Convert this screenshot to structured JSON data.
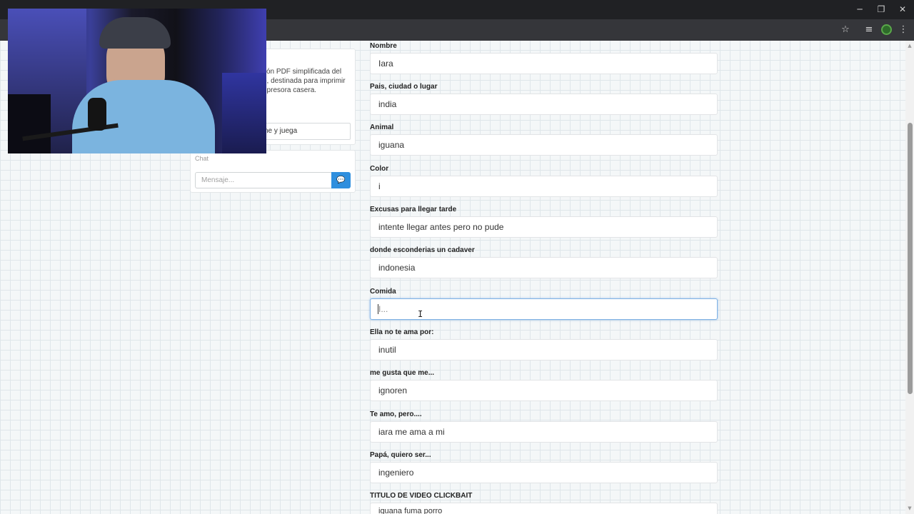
{
  "panel": {
    "description_lines": [
      "ón PDF simplificada del",
      "o, destinada para imprimir",
      "npresora casera."
    ],
    "share_text": "ne y juega",
    "chat_title": "Chat",
    "chat_placeholder": "Mensaje..."
  },
  "form": {
    "fields": [
      {
        "label": "Nombre",
        "value": ""
      },
      {
        "label": "Pais, ciudad o lugar",
        "value": "india"
      },
      {
        "label": "Animal",
        "value": "iguana"
      },
      {
        "label": "Color",
        "value": "i"
      },
      {
        "label": "Excusas para llegar tarde",
        "value": "intente llegar antes pero no pude"
      },
      {
        "label": "donde esconderias un cadaver",
        "value": "indonesia"
      },
      {
        "label": "Comida",
        "value": "",
        "placeholder": "I..."
      },
      {
        "label": "Ella no te ama por:",
        "value": "inutil"
      },
      {
        "label": "me gusta que me...",
        "value": "ignoren"
      },
      {
        "label": "Te amo, pero....",
        "value": "iara me ama a mi"
      },
      {
        "label": "Papá, quiero ser...",
        "value": "ingeniero"
      },
      {
        "label": "TITULO DE VIDEO CLICKBAIT",
        "value": "iguana fuma porro"
      }
    ],
    "first_value": "Iara"
  },
  "icons": {
    "minimize": "minimize-icon",
    "restore": "restore-icon",
    "close": "close-icon",
    "star": "star-icon",
    "media": "media-control-icon",
    "menu": "kebab-menu-icon",
    "send": "chat-send-icon"
  },
  "colors": {
    "accent": "#2f8fde",
    "focus_border": "#7fb3e6"
  }
}
